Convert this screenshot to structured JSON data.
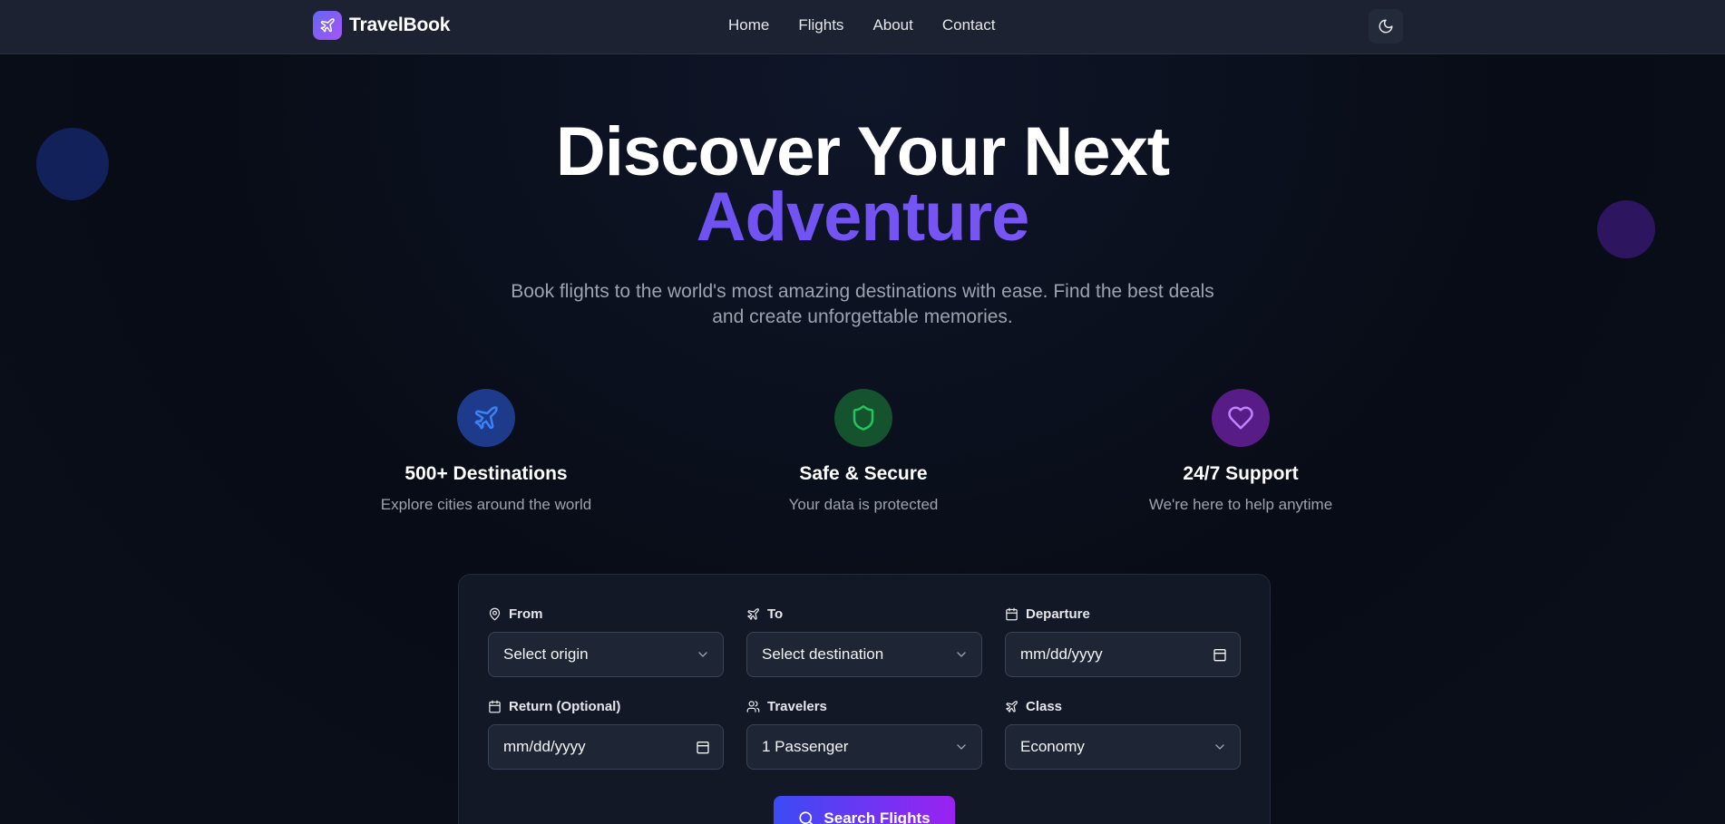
{
  "nav": {
    "brand": "TravelBook",
    "links": [
      "Home",
      "Flights",
      "About",
      "Contact"
    ]
  },
  "hero": {
    "title_line1": "Discover Your Next",
    "title_line2": "Adventure",
    "subtitle": "Book flights to the world's most amazing destinations with ease. Find the best deals and create unforgettable memories."
  },
  "features": [
    {
      "title": "500+ Destinations",
      "desc": "Explore cities around the world",
      "icon": "plane-icon",
      "color": "#3b82f6"
    },
    {
      "title": "Safe & Secure",
      "desc": "Your data is protected",
      "icon": "shield-icon",
      "color": "#22c55e"
    },
    {
      "title": "24/7 Support",
      "desc": "We're here to help anytime",
      "icon": "heart-icon",
      "color": "#c084fc"
    }
  ],
  "form": {
    "from": {
      "label": "From",
      "value": "Select origin"
    },
    "to": {
      "label": "To",
      "value": "Select destination"
    },
    "departure": {
      "label": "Departure",
      "value": "mm/dd/yyyy"
    },
    "return": {
      "label": "Return (Optional)",
      "value": "mm/dd/yyyy"
    },
    "travelers": {
      "label": "Travelers",
      "value": "1 Passenger"
    },
    "class": {
      "label": "Class",
      "value": "Economy"
    },
    "search_label": "Search Flights"
  },
  "colors": {
    "accent_gradient_start": "#3b4bf5",
    "accent_gradient_end": "#9b22f0",
    "title_accent": "#6b4ff0"
  }
}
